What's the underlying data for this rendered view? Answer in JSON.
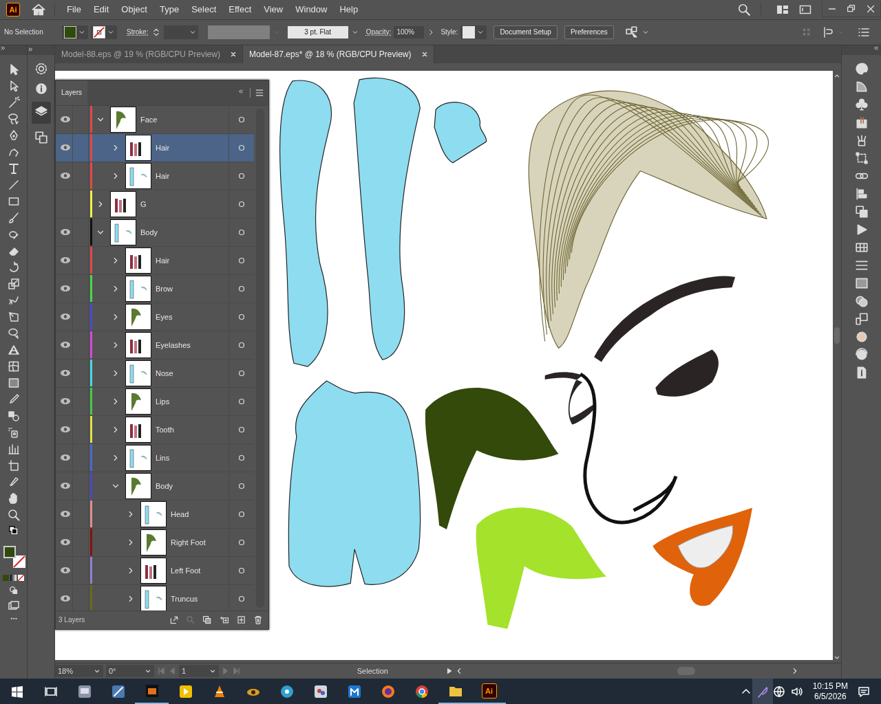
{
  "app": {
    "logo": "Ai"
  },
  "menu": [
    "File",
    "Edit",
    "Object",
    "Type",
    "Select",
    "Effect",
    "View",
    "Window",
    "Help"
  ],
  "control_bar": {
    "selection": "No Selection",
    "stroke_label": "Stroke:",
    "brush": "3 pt. Flat",
    "opacity_label": "Opacity:",
    "opacity": "100%",
    "style_label": "Style:",
    "buttons": [
      "Document Setup",
      "Preferences"
    ]
  },
  "tabs": [
    {
      "label": "Model-88.eps @ 19 % (RGB/CPU Preview)",
      "selected": false
    },
    {
      "label": "Model-87.eps* @ 18 % (RGB/CPU Preview)",
      "selected": true
    }
  ],
  "layers_panel": {
    "title": "Layers",
    "footer": "3 Layers",
    "layers": [
      {
        "name": "Face",
        "color": "#e04a4a",
        "visible": true,
        "expanded": true,
        "selected": false,
        "children": [
          {
            "name": "Hair",
            "color": "#e04a4a",
            "visible": true,
            "expanded": false,
            "selected": true
          },
          {
            "name": "Hair",
            "color": "#e04a4a",
            "visible": true,
            "expanded": false,
            "selected": false
          }
        ]
      },
      {
        "name": "G",
        "color": "#f0f048",
        "visible": false,
        "expanded": false,
        "selected": false
      },
      {
        "name": "Body",
        "color": "#111111",
        "visible": true,
        "expanded": true,
        "selected": false,
        "children": [
          {
            "name": "Hair",
            "color": "#e04a4a",
            "visible": true,
            "expanded": false,
            "selected": false
          },
          {
            "name": "Brow",
            "color": "#4ad84a",
            "visible": true,
            "expanded": false,
            "selected": false
          },
          {
            "name": "Eyes",
            "color": "#4a4ad0",
            "visible": true,
            "expanded": false,
            "selected": false
          },
          {
            "name": "Eyelashes",
            "color": "#d84ad8",
            "visible": true,
            "expanded": false,
            "selected": false
          },
          {
            "name": "Nose",
            "color": "#4ad8e0",
            "visible": true,
            "expanded": false,
            "selected": false
          },
          {
            "name": "Lips",
            "color": "#4ac84a",
            "visible": true,
            "expanded": false,
            "selected": false
          },
          {
            "name": "Tooth",
            "color": "#e0e04a",
            "visible": true,
            "expanded": false,
            "selected": false
          },
          {
            "name": "Lins",
            "color": "#4a6ad0",
            "visible": true,
            "expanded": false,
            "selected": false
          },
          {
            "name": "Body",
            "color": "#4a4ac0",
            "visible": true,
            "expanded": true,
            "selected": false,
            "children": [
              {
                "name": "Head",
                "color": "#e09090",
                "visible": true,
                "expanded": false,
                "selected": false
              },
              {
                "name": "Right Foot",
                "color": "#8a1010",
                "visible": true,
                "expanded": false,
                "selected": false
              },
              {
                "name": "Left Foot",
                "color": "#9080d0",
                "visible": true,
                "expanded": false,
                "selected": false
              },
              {
                "name": "Truncus",
                "color": "#6a6a18",
                "visible": true,
                "expanded": false,
                "selected": false
              }
            ]
          }
        ]
      }
    ]
  },
  "status_bar": {
    "zoom": "18%",
    "rotation": "0°",
    "artboard": "1",
    "tool": "Selection"
  },
  "taskbar": {
    "app_label": "Ai",
    "time": "10:15 PM",
    "date": "6/5/2026"
  }
}
